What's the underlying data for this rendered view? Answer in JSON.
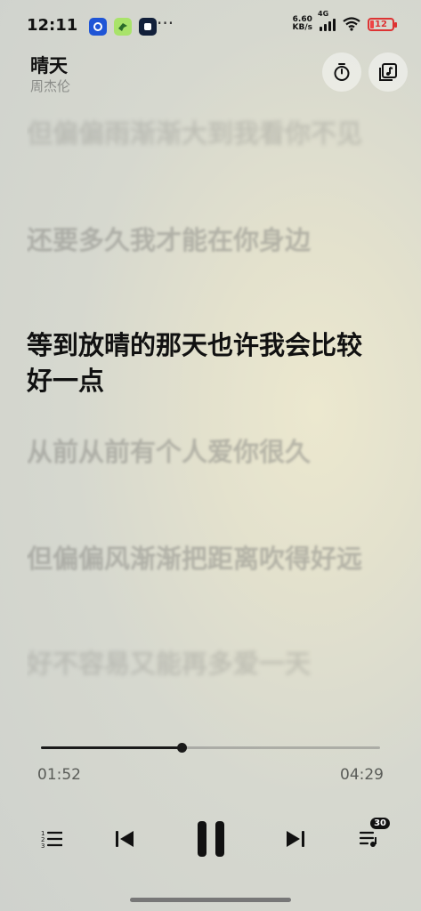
{
  "status_bar": {
    "time": "12:11",
    "more": "···",
    "net_speed_value": "6.60",
    "net_speed_unit": "KB/s",
    "signal_label": "4G",
    "battery": "12",
    "icons": [
      "app-notification-icon",
      "app-bird-icon",
      "app-square-icon",
      "signal-icon",
      "wifi-icon",
      "battery-icon"
    ]
  },
  "song": {
    "title": "晴天",
    "artist": "周杰伦"
  },
  "lyrics": {
    "lines": [
      {
        "text": "但偏偏雨渐渐大到我看你不见",
        "state": "past"
      },
      {
        "text": "还要多久我才能在你身边",
        "state": "past"
      },
      {
        "text": "等到放晴的那天也许我会比较好一点",
        "state": "current"
      },
      {
        "text": "从前从前有个人爱你很久",
        "state": "upcoming"
      },
      {
        "text": "但偏偏风渐渐把距离吹得好远",
        "state": "upcoming"
      },
      {
        "text": "好不容易又能再多爱一天",
        "state": "upcoming"
      }
    ]
  },
  "player": {
    "elapsed": "01:52",
    "total": "04:29",
    "progress_fraction": 0.416,
    "queue_count": "30"
  },
  "colors": {
    "accent": "#1a1a1a",
    "lyric_inactive": "#8c8c87",
    "battery_low": "#dd3333"
  }
}
